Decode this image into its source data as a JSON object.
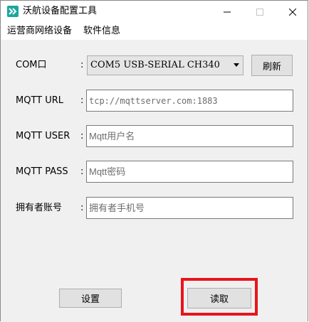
{
  "window": {
    "title": "沃航设备配置工具",
    "accent": "#1aa7a0"
  },
  "menu": {
    "items": [
      "运营商网络设备",
      "软件信息"
    ]
  },
  "form": {
    "com": {
      "label": "COM口",
      "colon": ":",
      "selected": "COM5 USB-SERIAL CH340",
      "refresh_label": "刷新"
    },
    "mqtt_url": {
      "label": "MQTT URL",
      "colon": ":",
      "value": "",
      "placeholder": "tcp://mqttserver.com:1883"
    },
    "mqtt_user": {
      "label": "MQTT USER",
      "colon": ":",
      "value": "",
      "placeholder": "Mqtt用户名"
    },
    "mqtt_pass": {
      "label": "MQTT PASS",
      "colon": ":",
      "value": "",
      "placeholder": "Mqtt密码"
    },
    "owner": {
      "label": "拥有者账号",
      "colon": ":",
      "value": "",
      "placeholder": "拥有者手机号"
    }
  },
  "actions": {
    "settings_label": "设置",
    "read_label": "读取"
  },
  "highlight": {
    "target": "read-button",
    "color": "#e8141c"
  }
}
